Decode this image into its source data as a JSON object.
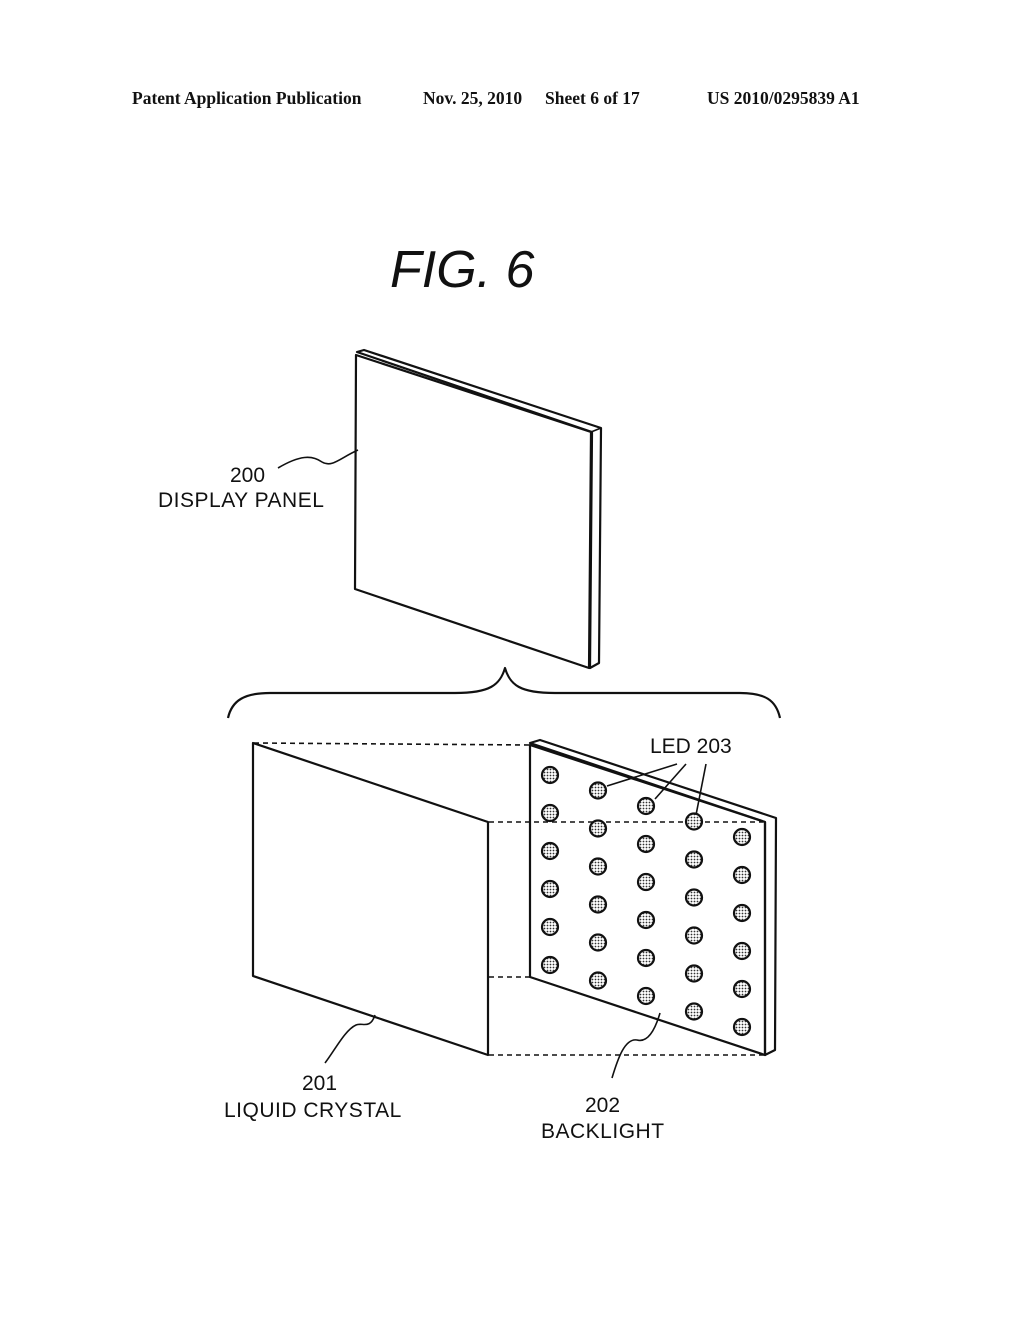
{
  "header": {
    "publication_type": "Patent Application Publication",
    "date": "Nov. 25, 2010",
    "sheet": "Sheet 6 of 17",
    "patent_number": "US 2010/0295839 A1"
  },
  "figure": {
    "title": "FIG. 6",
    "components": [
      {
        "ref": "200",
        "name": "DISPLAY PANEL"
      },
      {
        "ref": "201",
        "name": "LIQUID CRYSTAL"
      },
      {
        "ref": "202",
        "name": "BACKLIGHT"
      },
      {
        "ref": "LED 203",
        "name": "LED"
      }
    ],
    "led_grid": {
      "columns": 5,
      "rows": 6
    }
  }
}
